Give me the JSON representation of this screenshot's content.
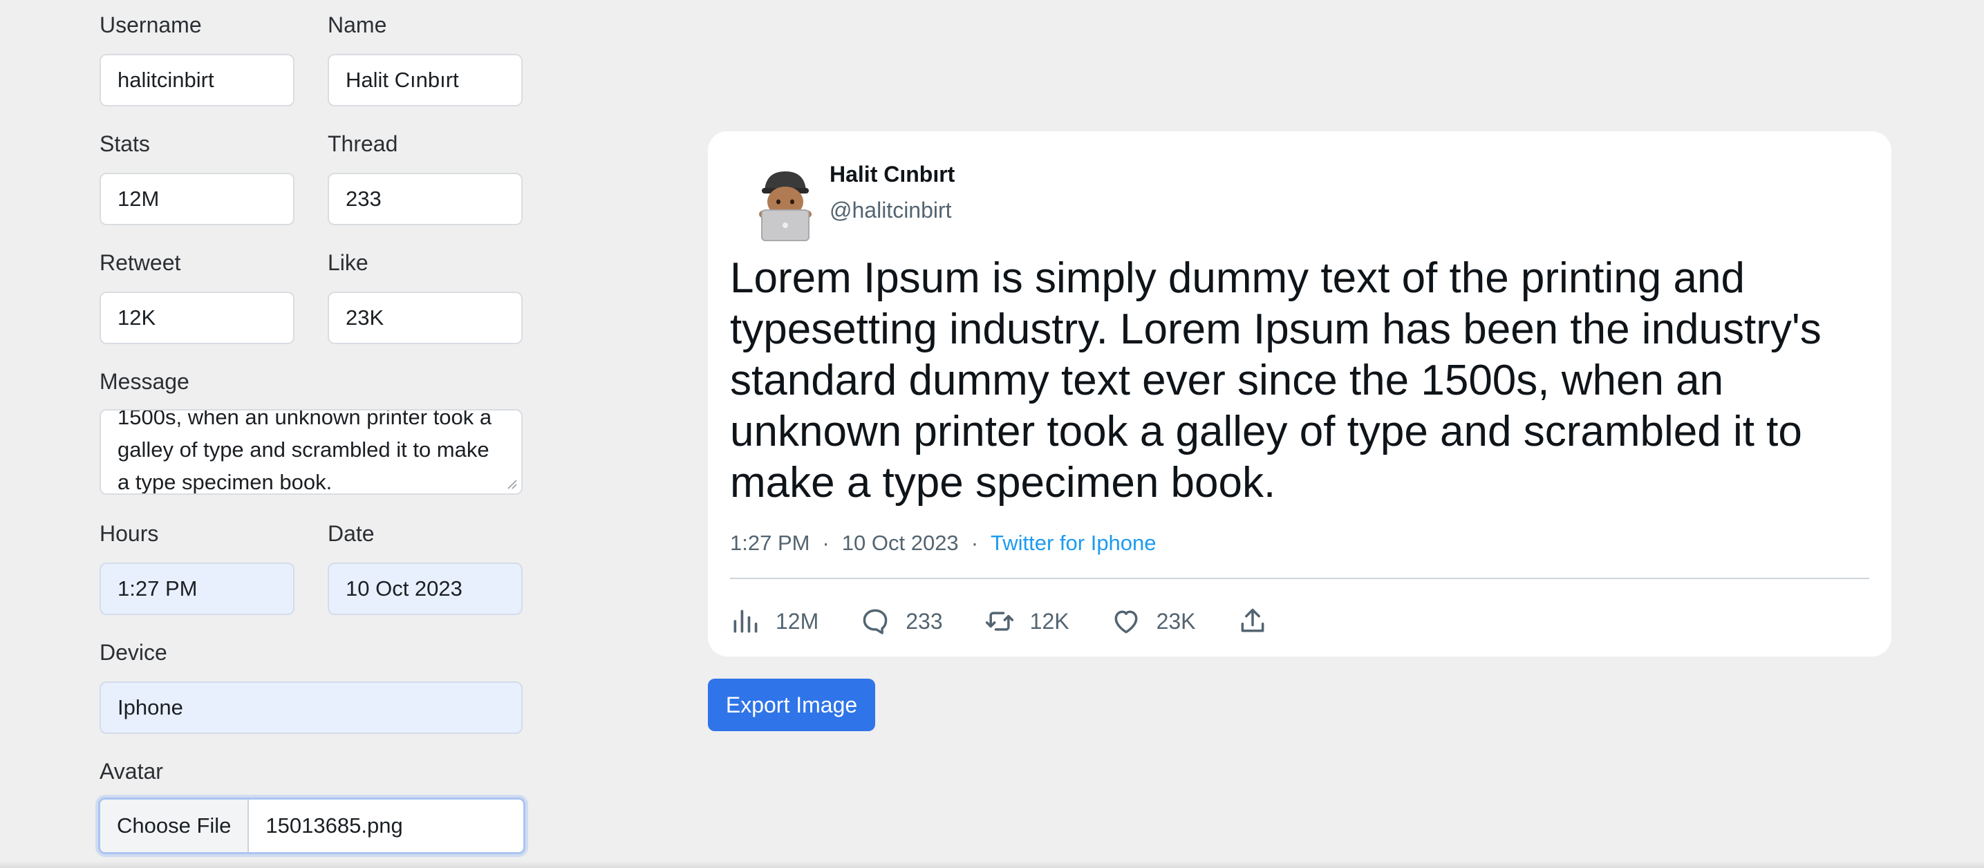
{
  "form": {
    "username": {
      "label": "Username",
      "value": "halitcinbirt"
    },
    "name": {
      "label": "Name",
      "value": "Halit Cınbırt"
    },
    "stats": {
      "label": "Stats",
      "value": "12M"
    },
    "thread": {
      "label": "Thread",
      "value": "233"
    },
    "retweet": {
      "label": "Retweet",
      "value": "12K"
    },
    "like": {
      "label": "Like",
      "value": "23K"
    },
    "message": {
      "label": "Message",
      "lines": [
        "1500s, when an unknown printer took a",
        "galley of type and scrambled it to make",
        "a type specimen book."
      ]
    },
    "hours": {
      "label": "Hours",
      "value": "1:27 PM"
    },
    "date": {
      "label": "Date",
      "value": "10 Oct 2023"
    },
    "device": {
      "label": "Device",
      "value": "Iphone"
    },
    "avatar": {
      "label": "Avatar",
      "button": "Choose File",
      "filename": "15013685.png"
    }
  },
  "tweet": {
    "display_name": "Halit Cınbırt",
    "handle": "@halitcinbirt",
    "text": "Lorem Ipsum is simply dummy text of the printing and typesetting industry. Lorem Ipsum has been the industry's standard dummy text ever since the 1500s, when an unknown printer took a galley of type and scrambled it to make a type specimen book.",
    "time": "1:27 PM",
    "separator": "·",
    "date": "10 Oct 2023",
    "source": "Twitter for Iphone",
    "actions": {
      "views": "12M",
      "replies": "233",
      "retweets": "12K",
      "likes": "23K"
    },
    "icons": {
      "avatar": "laptop-person-emoji",
      "views": "bar-chart-icon",
      "replies": "comment-icon",
      "retweets": "retweet-icon",
      "likes": "heart-icon",
      "share": "share-upload-icon"
    }
  },
  "export_button": "Export Image",
  "colors": {
    "page_bg": "#efefef",
    "accent": "#2f74e9",
    "link": "#1d9bf0",
    "muted": "#536471",
    "autofill": "#e8f0fe"
  }
}
